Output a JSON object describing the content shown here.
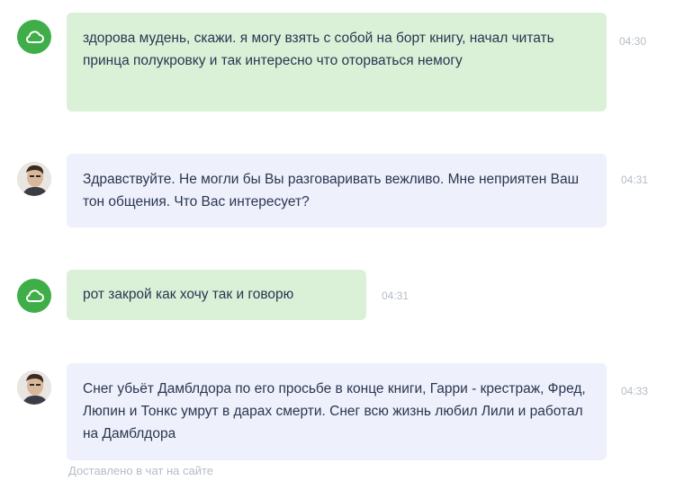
{
  "messages": [
    {
      "sender": "user",
      "text": "здорова мудень, скажи. я могу взять с собой на борт книгу, начал читать принца полукровку и так интересно что оторваться немогу",
      "time": "04:30"
    },
    {
      "sender": "support",
      "text": "Здравствуйте. Не могли бы Вы разговаривать вежливо. Мне неприятен Ваш тон общения. Что Вас интересует?",
      "time": "04:31"
    },
    {
      "sender": "user",
      "text": "рот закрой как хочу так и говорю",
      "time": "04:31"
    },
    {
      "sender": "support",
      "text": "Снег убьёт Дамблдора по его просьбе в конце книги, Гарри - крестраж, Фред, Люпин и Тонкс умрут в дарах смерти. Снег всю жизнь любил Лили и работал на Дамблдора",
      "time": "04:33"
    }
  ],
  "footer": {
    "delivery_status": "Доставлено в чат на сайте"
  },
  "colors": {
    "brand_green": "#3fae49",
    "user_bubble": "#daf1d8",
    "support_bubble": "#eef0fb",
    "time_text": "#b5bcc7"
  },
  "icons": {
    "user_avatar": "cloud-icon",
    "support_avatar": "agent-photo"
  }
}
